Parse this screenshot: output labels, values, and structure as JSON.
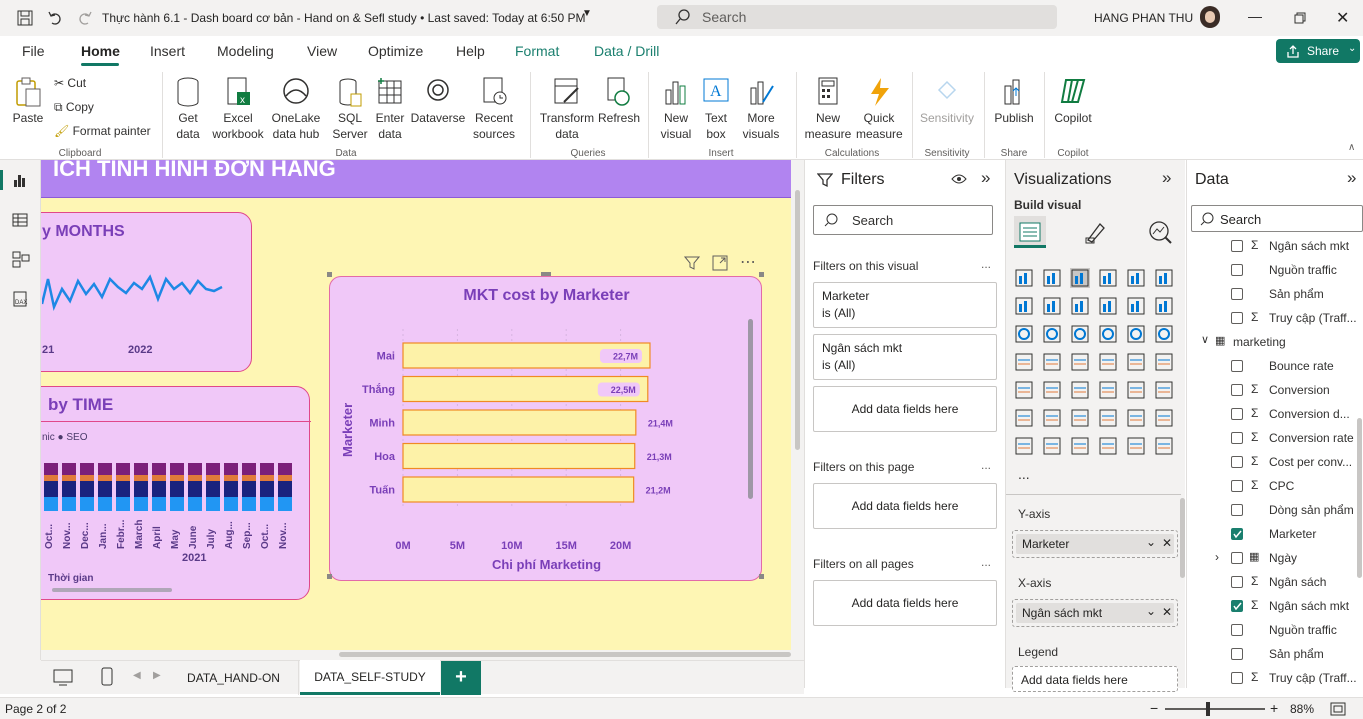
{
  "titlebar": {
    "title": "Thực hành 6.1 - Dash board cơ bản - Hand on & Sefl study • Last saved: Today at 6:50 PM",
    "search_placeholder": "Search",
    "user": "HANG PHAN THU"
  },
  "menu": {
    "tabs": [
      "File",
      "Home",
      "Insert",
      "Modeling",
      "View",
      "Optimize",
      "Help",
      "Format",
      "Data / Drill"
    ],
    "share": "Share"
  },
  "ribbon": {
    "clipboard": {
      "paste": "Paste",
      "cut": "Cut",
      "copy": "Copy",
      "format_painter": "Format painter",
      "group": "Clipboard"
    },
    "data": {
      "get_data": "Get data",
      "excel": "Excel workbook",
      "onelake": "OneLake data hub",
      "sql": "SQL Server",
      "enter": "Enter data",
      "dataverse": "Dataverse",
      "recent": "Recent sources",
      "group": "Data"
    },
    "queries": {
      "transform": "Transform data",
      "refresh": "Refresh",
      "group": "Queries"
    },
    "insert": {
      "new_visual": "New visual",
      "text_box": "Text box",
      "more_visuals": "More visuals",
      "group": "Insert"
    },
    "calculations": {
      "new_measure": "New measure",
      "quick_measure": "Quick measure",
      "group": "Calculations"
    },
    "sensitivity": {
      "label": "Sensitivity",
      "group": "Sensitivity"
    },
    "share": {
      "publish": "Publish",
      "group": "Share"
    },
    "copilot": {
      "label": "Copilot",
      "group": "Copilot"
    }
  },
  "canvas": {
    "header_text": "ÍCH TÌNH HÌNH ĐƠN HÀNG",
    "months_card": {
      "title": "y MONTHS",
      "x_ticks": [
        "21",
        "2022"
      ]
    },
    "time_card": {
      "title": "by TIME",
      "legend": "nic  ● SEO",
      "x_labels": [
        "Oct...",
        "Nov...",
        "Dec...",
        "Jan...",
        "Febr...",
        "March",
        "April",
        "May",
        "June",
        "July",
        "Aug...",
        "Sep...",
        "Oct...",
        "Nov..."
      ],
      "year": "2021",
      "axis": "Thời gian"
    },
    "mkt_chart": {
      "title": "MKT cost by Marketer",
      "ylabel": "Marketer",
      "xlabel": "Chi phí Marketing"
    }
  },
  "chart_data": {
    "type": "bar",
    "title": "MKT cost by Marketer",
    "categories": [
      "Mai",
      "Thắng",
      "Minh",
      "Hoa",
      "Tuấn"
    ],
    "values": [
      22.7,
      22.5,
      21.4,
      21.3,
      21.2
    ],
    "data_labels": [
      "22,7M",
      "22,5M",
      "21,4M",
      "21,3M",
      "21,2M"
    ],
    "x_ticks": [
      "0M",
      "5M",
      "10M",
      "15M",
      "20M"
    ],
    "xlim": [
      0,
      25
    ],
    "xlabel": "Chi phí Marketing",
    "ylabel": "Marketer",
    "bar_color": "#fdf2a8",
    "bar_border": "#f08a24"
  },
  "filters": {
    "title": "Filters",
    "search": "Search",
    "on_visual": "Filters on this visual",
    "card1_title": "Marketer",
    "card1_value": "is (All)",
    "card2_title": "Ngân sách mkt",
    "card2_value": "is (All)",
    "add_fields": "Add data fields here",
    "on_page": "Filters on this page",
    "on_all": "Filters on all pages",
    "more": "..."
  },
  "viz": {
    "title": "Visualizations",
    "build": "Build visual",
    "yaxis": "Y-axis",
    "yfield": "Marketer",
    "xaxis": "X-axis",
    "xfield": "Ngân sách mkt",
    "legend": "Legend",
    "add_fields": "Add data fields here",
    "more": "..."
  },
  "data_pane": {
    "title": "Data",
    "search": "Search",
    "rows": [
      {
        "label": "Ngân sách mkt",
        "sigma": true,
        "checked": false,
        "indent": 1
      },
      {
        "label": "Nguồn traffic",
        "sigma": false,
        "checked": false,
        "indent": 1
      },
      {
        "label": "Sản phẩm",
        "sigma": false,
        "checked": false,
        "indent": 1
      },
      {
        "label": "Truy cập (Traff...",
        "sigma": true,
        "checked": false,
        "indent": 1
      },
      {
        "label": "marketing",
        "sigma": false,
        "checked": false,
        "indent": 0,
        "table": true
      },
      {
        "label": "Bounce rate",
        "sigma": false,
        "checked": false,
        "indent": 1
      },
      {
        "label": "Conversion",
        "sigma": true,
        "checked": false,
        "indent": 1
      },
      {
        "label": "Conversion d...",
        "sigma": true,
        "checked": false,
        "indent": 1
      },
      {
        "label": "Conversion rate",
        "sigma": true,
        "checked": false,
        "indent": 1
      },
      {
        "label": "Cost per conv...",
        "sigma": true,
        "checked": false,
        "indent": 1
      },
      {
        "label": "CPC",
        "sigma": true,
        "checked": false,
        "indent": 1
      },
      {
        "label": "Dòng sản phẩm",
        "sigma": false,
        "checked": false,
        "indent": 1
      },
      {
        "label": "Marketer",
        "sigma": false,
        "checked": true,
        "indent": 1
      },
      {
        "label": "Ngày",
        "sigma": false,
        "checked": false,
        "indent": 1,
        "calendar": true
      },
      {
        "label": "Ngân sách",
        "sigma": true,
        "checked": false,
        "indent": 1
      },
      {
        "label": "Ngân sách mkt",
        "sigma": true,
        "checked": true,
        "indent": 1
      },
      {
        "label": "Nguồn traffic",
        "sigma": false,
        "checked": false,
        "indent": 1
      },
      {
        "label": "Sản phẩm",
        "sigma": false,
        "checked": false,
        "indent": 1
      },
      {
        "label": "Truy cập (Traff...",
        "sigma": true,
        "checked": false,
        "indent": 1
      }
    ]
  },
  "tabs": {
    "pages": [
      "DATA_HAND-ON",
      "DATA_SELF-STUDY"
    ],
    "add": "+"
  },
  "status": {
    "page": "Page 2 of 2",
    "zoom": "88%"
  }
}
